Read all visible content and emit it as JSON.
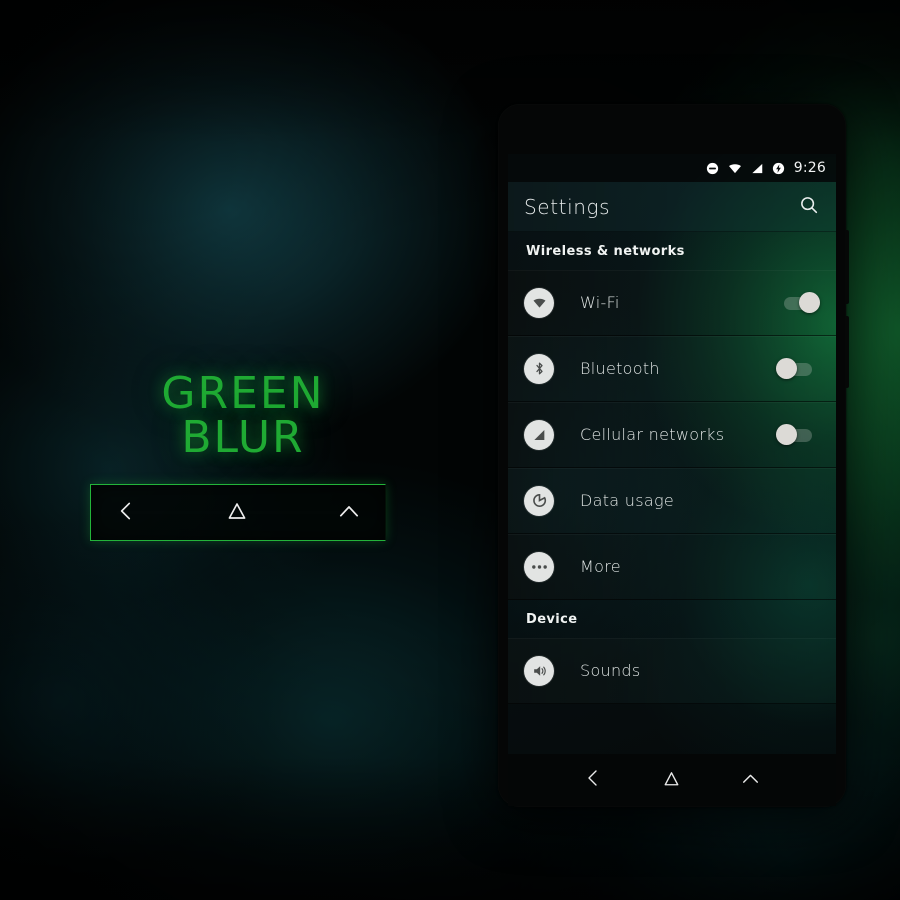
{
  "wallpaper": {
    "accent_green": "#1faa33",
    "glow_green": "#18843e",
    "teal": "#124048",
    "background": "#020505"
  },
  "brand": {
    "title": "GREEN BLUR",
    "nav_preview": {
      "back_icon": "back-chevron-icon",
      "home_icon": "home-triangle-icon",
      "recents_icon": "recents-caret-icon"
    }
  },
  "phone": {
    "statusbar": {
      "time": "9:26",
      "icons": [
        {
          "name": "do-not-disturb-icon"
        },
        {
          "name": "wifi-icon"
        },
        {
          "name": "cellular-signal-icon"
        },
        {
          "name": "battery-charging-icon"
        }
      ]
    },
    "actionbar": {
      "title": "Settings",
      "search_icon": "search-icon"
    },
    "sections": [
      {
        "header": "Wireless & networks",
        "rows": [
          {
            "label": "Wi-Fi",
            "icon": "wifi-icon",
            "toggle": "on"
          },
          {
            "label": "Bluetooth",
            "icon": "bluetooth-icon",
            "toggle": "off"
          },
          {
            "label": "Cellular networks",
            "icon": "signal-icon",
            "toggle": "off"
          },
          {
            "label": "Data usage",
            "icon": "data-usage-icon",
            "toggle": null
          },
          {
            "label": "More",
            "icon": "more-icon",
            "toggle": null
          }
        ]
      },
      {
        "header": "Device",
        "rows": [
          {
            "label": "Sounds",
            "icon": "volume-icon",
            "toggle": null
          }
        ]
      }
    ],
    "navbar": {
      "back_icon": "back-chevron-icon",
      "home_icon": "home-triangle-icon",
      "recents_icon": "recents-caret-icon"
    }
  }
}
